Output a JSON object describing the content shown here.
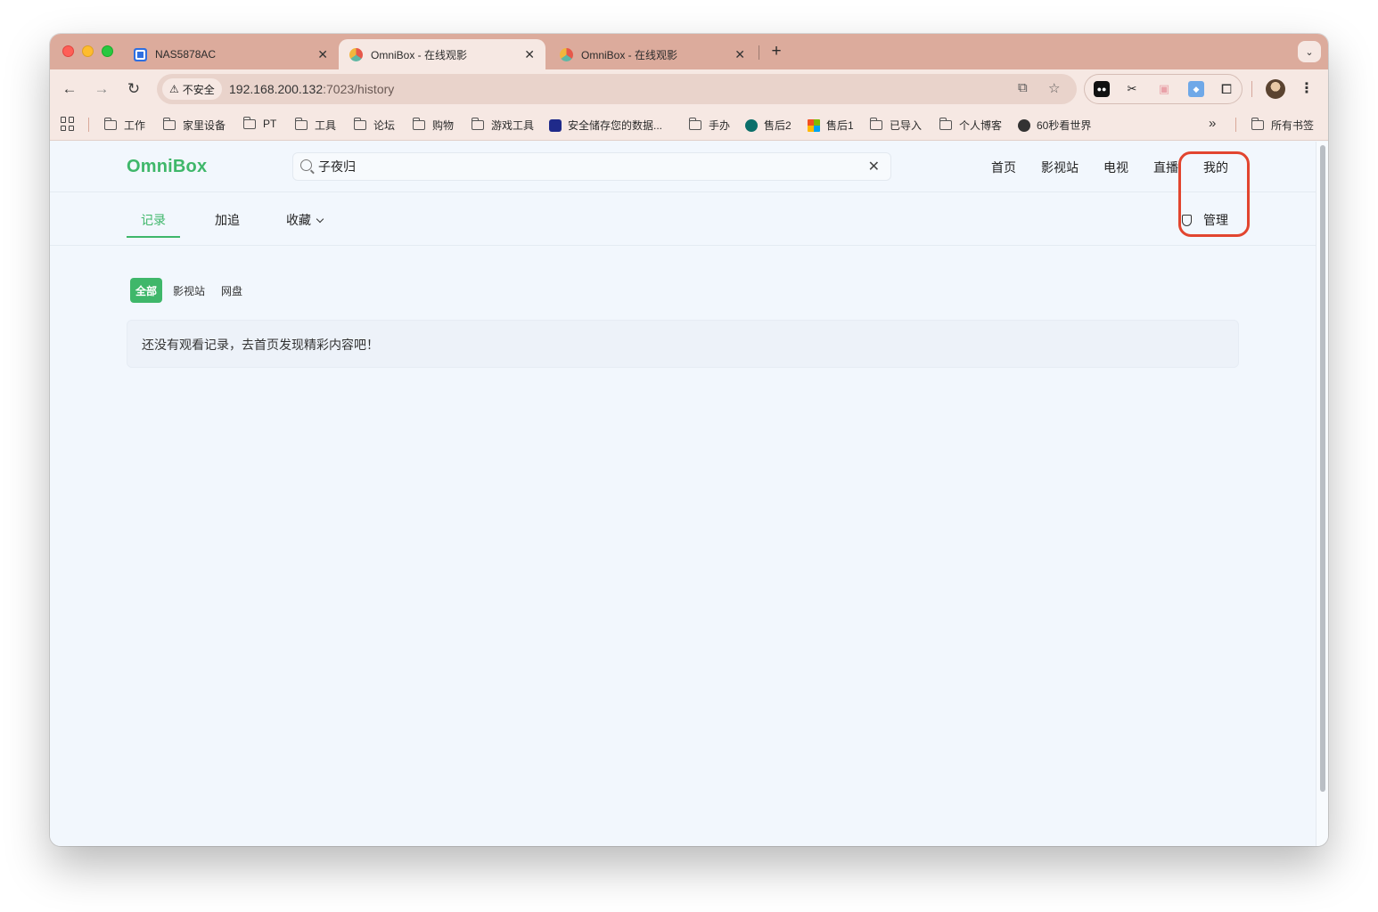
{
  "tabs": [
    {
      "title": "NAS5878AC",
      "active": false
    },
    {
      "title": "OmniBox - 在线观影",
      "active": true
    },
    {
      "title": "OmniBox - 在线观影",
      "active": false
    }
  ],
  "toolbar": {
    "security_label": "不安全",
    "url_host": "192.168.200.132",
    "url_path": ":7023/history"
  },
  "bookmarks": [
    {
      "label": "工作",
      "type": "folder"
    },
    {
      "label": "家里设备",
      "type": "folder"
    },
    {
      "label": "PT",
      "type": "folder"
    },
    {
      "label": "工具",
      "type": "folder"
    },
    {
      "label": "论坛",
      "type": "folder"
    },
    {
      "label": "购物",
      "type": "folder"
    },
    {
      "label": "游戏工具",
      "type": "folder"
    },
    {
      "label": "安全储存您的数据...",
      "type": "site",
      "color": "#1f2a8a"
    },
    {
      "label": "手办",
      "type": "folder"
    },
    {
      "label": "售后2",
      "type": "site",
      "color": "#0b6f6a"
    },
    {
      "label": "售后1",
      "type": "site",
      "color": "#f25022"
    },
    {
      "label": "已导入",
      "type": "folder"
    },
    {
      "label": "个人博客",
      "type": "folder"
    },
    {
      "label": "60秒看世界",
      "type": "site",
      "color": "#333333"
    }
  ],
  "all_bookmarks_label": "所有书签",
  "app": {
    "logo": "OmniBox",
    "brand_color": "#3fb76a",
    "search_value": "子夜归",
    "nav": [
      "首页",
      "影视站",
      "电视",
      "直播",
      "我的"
    ],
    "subtabs": [
      "记录",
      "加追",
      "收藏"
    ],
    "admin_label": "管理",
    "filters": [
      "全部",
      "影视站",
      "网盘"
    ],
    "empty_message": "还没有观看记录，去首页发现精彩内容吧！"
  }
}
